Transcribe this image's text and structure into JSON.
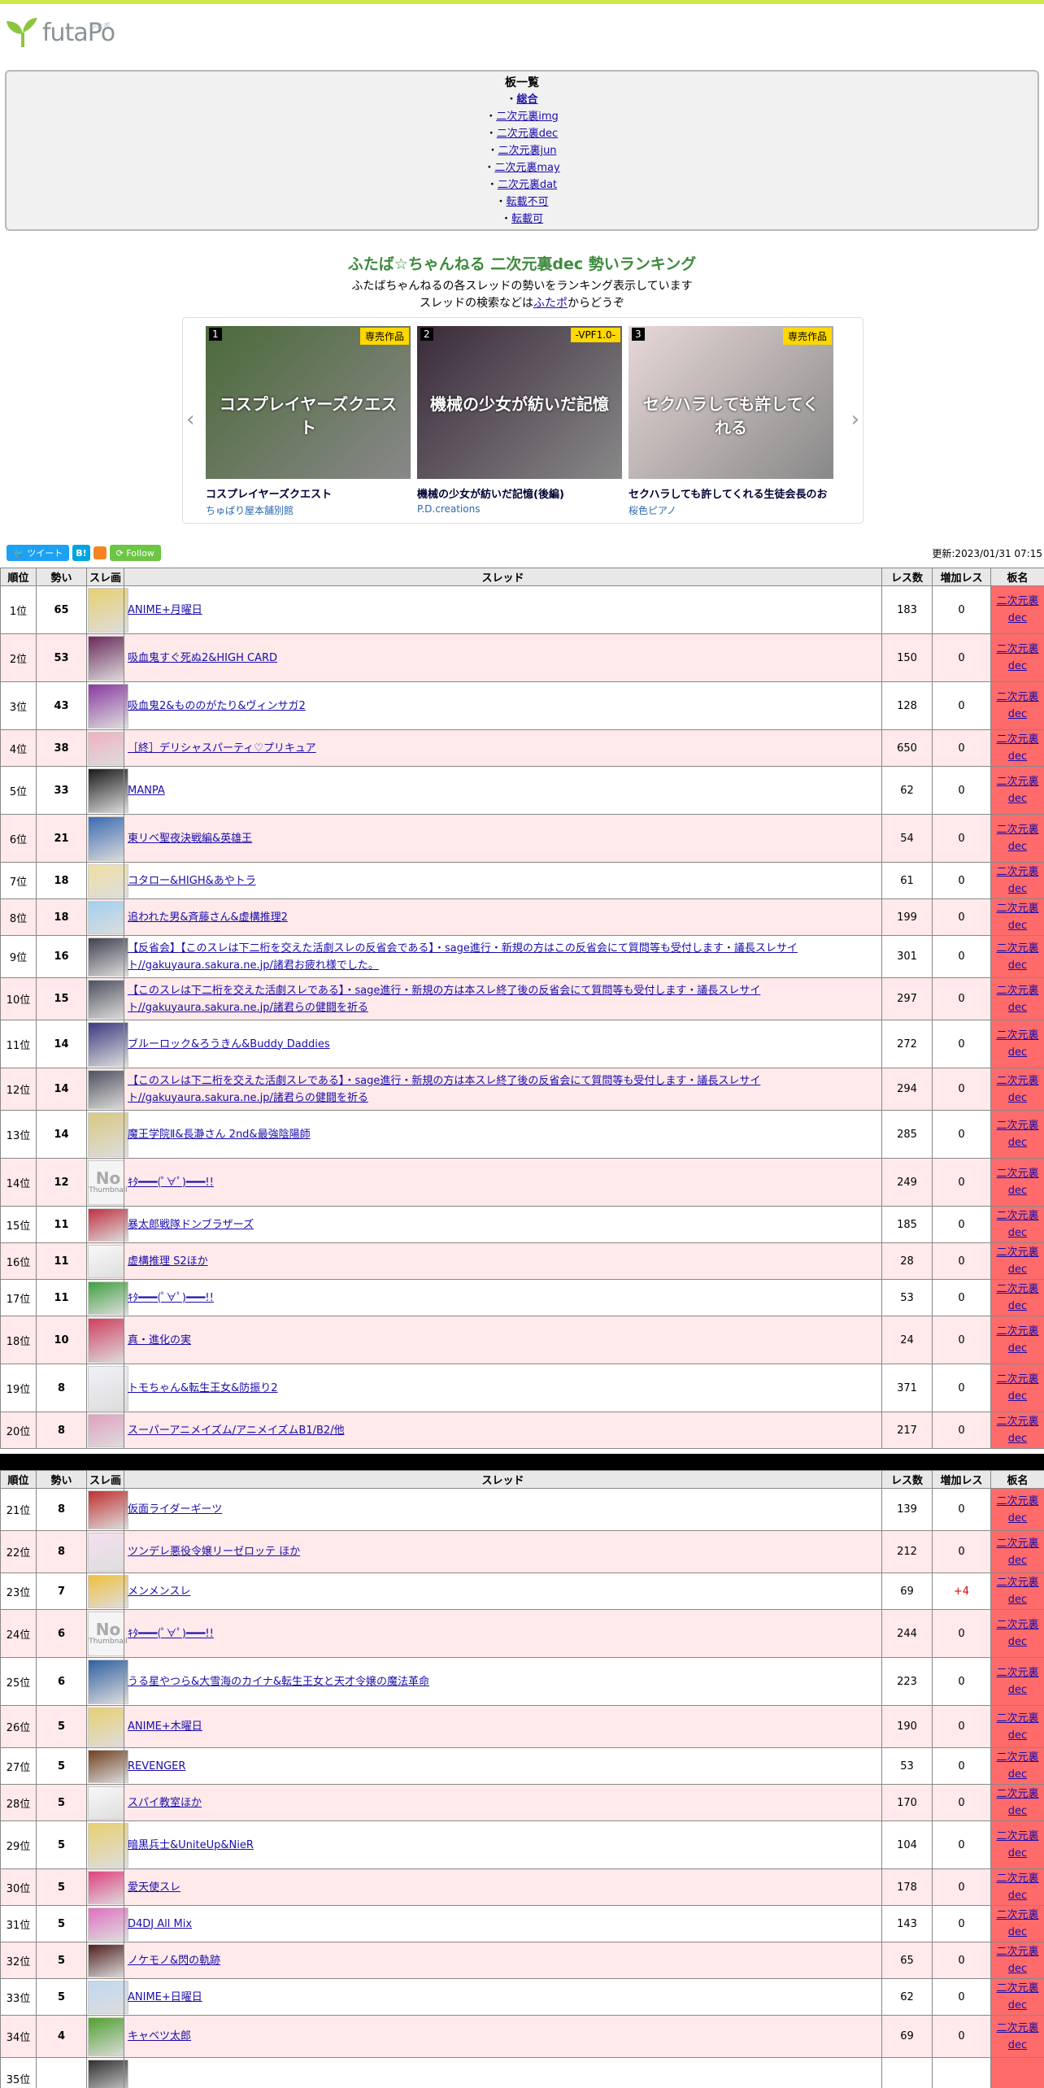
{
  "brand": {
    "name": "futaPo",
    "sub": "ふたポ"
  },
  "boards": {
    "heading": "板一覧",
    "items": [
      {
        "label": "総合",
        "active": true
      },
      {
        "label": "二次元裏img"
      },
      {
        "label": "二次元裏dec"
      },
      {
        "label": "二次元裏jun"
      },
      {
        "label": "二次元裏may"
      },
      {
        "label": "二次元裏dat"
      },
      {
        "label": "転載不可"
      },
      {
        "label": "転載可"
      },
      {
        "label": "二次元..."
      }
    ]
  },
  "page": {
    "title": "ふたば☆ちゃんねる 二次元裏dec 勢いランキング",
    "desc_line1": "ふたばちゃんねるの各スレッドの勢いをランキング表示しています",
    "desc_line2_pre": "スレッドの検索などは",
    "desc_line2_link": "ふたポ",
    "desc_line2_post": "からどうぞ",
    "updated": "更新:2023/01/31 07:15"
  },
  "carousel": [
    {
      "num": "1",
      "badge": "専売作品",
      "title": "コスプレイヤーズクエスト",
      "maker": "ちゅぱり屋本舗別館",
      "color": "#4c6a3a",
      "img_text": "コスプレイヤーズクエスト"
    },
    {
      "num": "2",
      "badge": "-VPF1.0-",
      "title": "機械の少女が紡いだ記憶(後編)",
      "maker": "P.D.creations",
      "color": "#3a2a3a",
      "img_text": "機械の少女が紡いだ記憶"
    },
    {
      "num": "3",
      "badge": "専売作品",
      "title": "セクハラしても許してくれる生徒会長のお",
      "maker": "桜色ピアノ",
      "color": "#e8d8d8",
      "img_text": "セクハラしても許してくれる"
    }
  ],
  "social": {
    "tweet": "ツイート",
    "hatena": "B!",
    "follow": "Follow"
  },
  "columns": {
    "rank": "順位",
    "momentum": "勢い",
    "thumb": "スレ画",
    "thread": "スレッド",
    "res": "レス数",
    "inc": "増加レス",
    "board": "板名"
  },
  "rows1": [
    {
      "rank": "1位",
      "m": "65",
      "t": "ANIME+月曜日",
      "res": "183",
      "inc": "0",
      "b1": "二次元裏",
      "b2": "dec",
      "c": "#e8d070"
    },
    {
      "rank": "2位",
      "m": "53",
      "t": "吸血鬼すぐ死ぬ2&HIGH CARD",
      "res": "150",
      "inc": "0",
      "b1": "二次元裏",
      "b2": "dec",
      "c": "#6a2a5a"
    },
    {
      "rank": "3位",
      "m": "43",
      "t": "吸血鬼2&もののがたり&ヴィンサガ2",
      "res": "128",
      "inc": "0",
      "b1": "二次元裏",
      "b2": "dec",
      "c": "#8a3aa0"
    },
    {
      "rank": "4位",
      "m": "38",
      "t": "［終］デリシャスパーティ♡プリキュア",
      "res": "650",
      "inc": "0",
      "b1": "二次元裏",
      "b2": "dec",
      "c": "#f0b0c0"
    },
    {
      "rank": "5位",
      "m": "33",
      "t": "MANPA",
      "res": "62",
      "inc": "0",
      "b1": "二次元裏",
      "b2": "dec",
      "c": "#1a1a1a"
    },
    {
      "rank": "6位",
      "m": "21",
      "t": "東リベ聖夜決戦編&英雄王",
      "res": "54",
      "inc": "0",
      "b1": "二次元裏",
      "b2": "dec",
      "c": "#3a6ab0"
    },
    {
      "rank": "7位",
      "m": "18",
      "t": "コタロー&HIGH&あやトラ",
      "res": "61",
      "inc": "0",
      "b1": "二次元裏",
      "b2": "dec",
      "c": "#f0e0a0"
    },
    {
      "rank": "8位",
      "m": "18",
      "t": "追われた男&斉藤さん&虚構推理2",
      "res": "199",
      "inc": "0",
      "b1": "二次元裏",
      "b2": "dec",
      "c": "#a0d0f0"
    },
    {
      "rank": "9位",
      "m": "16",
      "t": "【反省会】【このスレは下二桁を交えた活劇スレの反省会である】・sage進行・新規の方はこの反省会にて質問等も受付します・議長スレサイト//gakuyaura.sakura.ne.jp/諸君お疲れ様でした。",
      "res": "301",
      "inc": "0",
      "b1": "二次元裏",
      "b2": "dec",
      "c": "#404050"
    },
    {
      "rank": "10位",
      "m": "15",
      "t": "【このスレは下二桁を交えた活劇スレである】・sage進行・新規の方は本スレ終了後の反省会にて質問等も受付します・議長スレサイト//gakuyaura.sakura.ne.jp/諸君らの健闘を祈る",
      "res": "297",
      "inc": "0",
      "b1": "二次元裏",
      "b2": "dec",
      "c": "#505060"
    },
    {
      "rank": "11位",
      "m": "14",
      "t": "ブルーロック&ろうきん&Buddy Daddies",
      "res": "272",
      "inc": "0",
      "b1": "二次元裏",
      "b2": "dec",
      "c": "#3a3a80"
    },
    {
      "rank": "12位",
      "m": "14",
      "t": "【このスレは下二桁を交えた活劇スレである】・sage進行・新規の方は本スレ終了後の反省会にて質問等も受付します・議長スレサイト//gakuyaura.sakura.ne.jp/諸君らの健闘を祈る",
      "res": "294",
      "inc": "0",
      "b1": "二次元裏",
      "b2": "dec",
      "c": "#505060"
    },
    {
      "rank": "13位",
      "m": "14",
      "t": "魔王学院Ⅱ&長瀞さん 2nd&最強陰陽師",
      "res": "285",
      "inc": "0",
      "b1": "二次元裏",
      "b2": "dec",
      "c": "#d8c880"
    },
    {
      "rank": "14位",
      "m": "12",
      "t": "ｷﾀ━━━(ﾟ∀ﾟ)━━━!!",
      "res": "249",
      "inc": "0",
      "b1": "二次元裏",
      "b2": "dec",
      "c": "none"
    },
    {
      "rank": "15位",
      "m": "11",
      "t": "暴太郎戦隊ドンブラザーズ",
      "res": "185",
      "inc": "0",
      "b1": "二次元裏",
      "b2": "dec",
      "c": "#c03040"
    },
    {
      "rank": "16位",
      "m": "11",
      "t": "虚構推理 S2ほか",
      "res": "28",
      "inc": "0",
      "b1": "二次元裏",
      "b2": "dec",
      "c": "#f8f8f8"
    },
    {
      "rank": "17位",
      "m": "11",
      "t": "ｷﾀ━━━(ﾟ∀ﾟ)━━━!!",
      "res": "53",
      "inc": "0",
      "b1": "二次元裏",
      "b2": "dec",
      "c": "#40a040"
    },
    {
      "rank": "18位",
      "m": "10",
      "t": "真・進化の実",
      "res": "24",
      "inc": "0",
      "b1": "二次元裏",
      "b2": "dec",
      "c": "#d04060"
    },
    {
      "rank": "19位",
      "m": "8",
      "t": "トモちゃん&転生王女&防振り2",
      "res": "371",
      "inc": "0",
      "b1": "二次元裏",
      "b2": "dec",
      "c": "#f0f0f8"
    },
    {
      "rank": "20位",
      "m": "8",
      "t": "スーパーアニメイズム/アニメイズムB1/B2/他",
      "res": "217",
      "inc": "0",
      "b1": "二次元裏",
      "b2": "dec",
      "c": "#e0a0c0"
    }
  ],
  "rows2": [
    {
      "rank": "21位",
      "m": "8",
      "t": "仮面ライダーギーツ",
      "res": "139",
      "inc": "0",
      "b1": "二次元裏",
      "b2": "dec",
      "c": "#c03030"
    },
    {
      "rank": "22位",
      "m": "8",
      "t": "ツンデレ悪役令嬢リーゼロッテ ほか",
      "res": "212",
      "inc": "0",
      "b1": "二次元裏",
      "b2": "dec",
      "c": "#f4e0f0"
    },
    {
      "rank": "23位",
      "m": "7",
      "t": "メンメンスレ",
      "res": "69",
      "inc": "+4",
      "b1": "二次元裏",
      "b2": "dec",
      "c": "#f0c040"
    },
    {
      "rank": "24位",
      "m": "6",
      "t": "ｷﾀ━━━(ﾟ∀ﾟ)━━━!!",
      "res": "244",
      "inc": "0",
      "b1": "二次元裏",
      "b2": "dec",
      "c": "none"
    },
    {
      "rank": "25位",
      "m": "6",
      "t": "うる星やつら&大雪海のカイナ&転生王女と天才令嬢の魔法革命",
      "res": "223",
      "inc": "0",
      "b1": "二次元裏",
      "b2": "dec",
      "c": "#3060a0"
    },
    {
      "rank": "26位",
      "m": "5",
      "t": "ANIME+木曜日",
      "res": "190",
      "inc": "0",
      "b1": "二次元裏",
      "b2": "dec",
      "c": "#e8d070"
    },
    {
      "rank": "27位",
      "m": "5",
      "t": "REVENGER",
      "res": "53",
      "inc": "0",
      "b1": "二次元裏",
      "b2": "dec",
      "c": "#704020"
    },
    {
      "rank": "28位",
      "m": "5",
      "t": "スパイ教室ほか",
      "res": "170",
      "inc": "0",
      "b1": "二次元裏",
      "b2": "dec",
      "c": "#f8f8f8"
    },
    {
      "rank": "29位",
      "m": "5",
      "t": "暗黒兵士&UniteUp&NieR",
      "res": "104",
      "inc": "0",
      "b1": "二次元裏",
      "b2": "dec",
      "c": "#e8d070"
    },
    {
      "rank": "30位",
      "m": "5",
      "t": "愛天使スレ",
      "res": "178",
      "inc": "0",
      "b1": "二次元裏",
      "b2": "dec",
      "c": "#e04080"
    },
    {
      "rank": "31位",
      "m": "5",
      "t": "D4DJ All Mix",
      "res": "143",
      "inc": "0",
      "b1": "二次元裏",
      "b2": "dec",
      "c": "#e070c0"
    },
    {
      "rank": "32位",
      "m": "5",
      "t": "ノケモノ&閃の軌跡",
      "res": "65",
      "inc": "0",
      "b1": "二次元裏",
      "b2": "dec",
      "c": "#502020"
    },
    {
      "rank": "33位",
      "m": "5",
      "t": "ANIME+日曜日",
      "res": "62",
      "inc": "0",
      "b1": "二次元裏",
      "b2": "dec",
      "c": "#c0d8f0"
    },
    {
      "rank": "34位",
      "m": "4",
      "t": "キャベツ太郎",
      "res": "69",
      "inc": "0",
      "b1": "二次元裏",
      "b2": "dec",
      "c": "#50a030"
    },
    {
      "rank": "35位",
      "m": "",
      "t": "",
      "res": "",
      "inc": "",
      "b1": "",
      "b2": "",
      "c": "#303030"
    }
  ],
  "noth": {
    "big": "No",
    "small": "Thumbnail"
  }
}
